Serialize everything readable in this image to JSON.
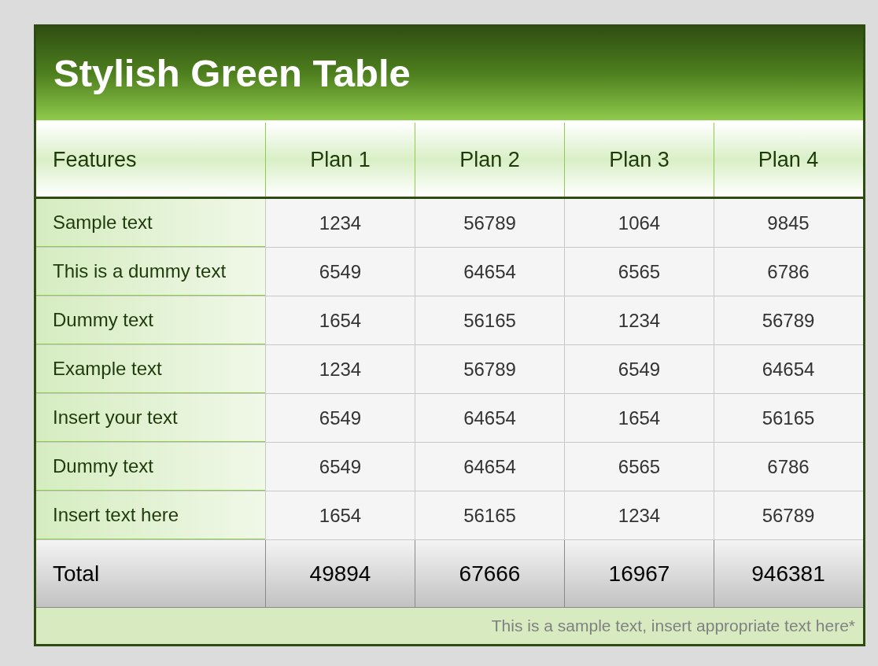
{
  "title": "Stylish Green Table",
  "table": {
    "columns": [
      "Features",
      "Plan 1",
      "Plan 2",
      "Plan 3",
      "Plan 4"
    ],
    "rows": [
      [
        "Sample text",
        "1234",
        "56789",
        "1064",
        "9845"
      ],
      [
        "This is a dummy text",
        "6549",
        "64654",
        "6565",
        "6786"
      ],
      [
        "Dummy text",
        "1654",
        "56165",
        "1234",
        "56789"
      ],
      [
        "Example text",
        "1234",
        "56789",
        "6549",
        "64654"
      ],
      [
        "Insert your text",
        "6549",
        "64654",
        "1654",
        "56165"
      ],
      [
        "Dummy text",
        "6549",
        "64654",
        "6565",
        "6786"
      ],
      [
        "Insert text here",
        "1654",
        "56165",
        "1234",
        "56789"
      ]
    ],
    "total": [
      "Total",
      "49894",
      "67666",
      "16967",
      "946381"
    ]
  },
  "footnote": "This is a sample text, insert appropriate text here*"
}
